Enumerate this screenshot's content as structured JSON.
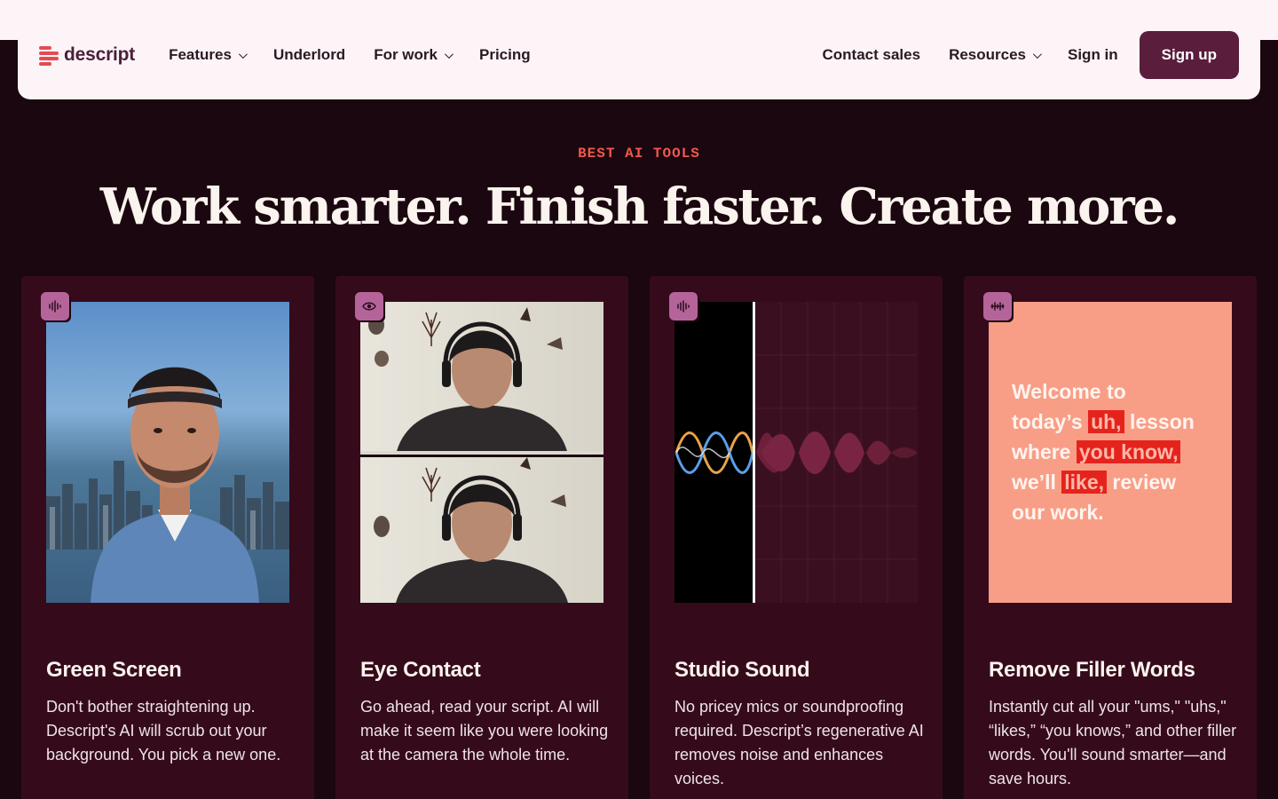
{
  "nav": {
    "logo_text": "descript",
    "links": [
      {
        "label": "Features",
        "has_dropdown": true
      },
      {
        "label": "Underlord",
        "has_dropdown": false
      },
      {
        "label": "For work",
        "has_dropdown": true
      },
      {
        "label": "Pricing",
        "has_dropdown": false
      }
    ],
    "right": {
      "contact": "Contact sales",
      "resources": "Resources",
      "signin": "Sign in",
      "signup": "Sign up"
    }
  },
  "hero": {
    "eyebrow": "BEST AI TOOLS",
    "headline": "Work smarter. Finish faster. Create more."
  },
  "cards": [
    {
      "title": "Green Screen",
      "description": "Don't bother straightening up. Descript's AI will scrub out your background. You pick a new one.",
      "icon": "waveform-icon"
    },
    {
      "title": "Eye Contact",
      "description": "Go ahead, read your script. AI will make it seem like you were looking at the camera the whole time.",
      "icon": "eye-icon"
    },
    {
      "title": "Studio Sound",
      "description": "No pricey mics or soundproofing required. Descript’s regenerative AI removes noise and enhances voices.",
      "icon": "waveform-icon"
    },
    {
      "title": "Remove Filler Words",
      "description": "Instantly cut all your \"ums,\" \"uhs,\" “likes,” “you knows,” and other filler words. You'll sound smarter—and save hours.",
      "icon": "filler-words-icon"
    }
  ],
  "filler_demo": {
    "line1": "Welcome to",
    "line2a": "today’s",
    "line2b": "uh,",
    "line2c": "lesson",
    "line3a": "where",
    "line3b": "you know,",
    "line4a": "we’ll",
    "line4b": "like,",
    "line4c": "review",
    "line5": "our work."
  },
  "colors": {
    "background": "#1b070f",
    "card": "#350b1c",
    "accent": "#f0584e",
    "button": "#5a1d3c",
    "badge": "#b5649a"
  }
}
